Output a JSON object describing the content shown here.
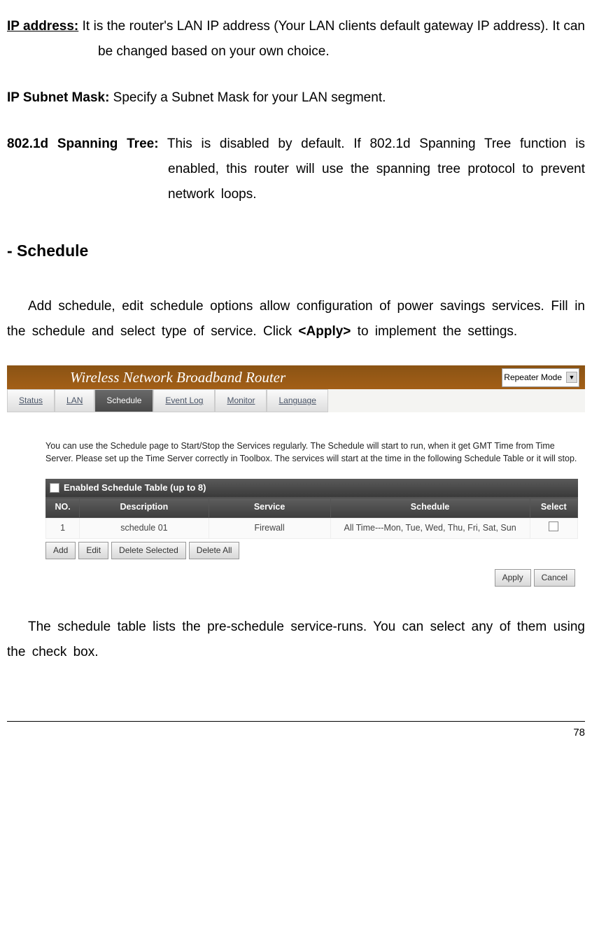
{
  "definitions": {
    "ip_address": {
      "label": "IP address:",
      "text": " It is the router's LAN IP address (Your LAN clients default gateway IP address). It can be changed based on your own choice."
    },
    "subnet": {
      "label": "IP Subnet Mask:",
      "text": " Specify a Subnet Mask for your LAN segment."
    },
    "spanning": {
      "label": "802.1d Spanning Tree:",
      "text": " This is disabled by default. If 802.1d Spanning Tree function is enabled, this router will use the spanning tree protocol to prevent network loops."
    }
  },
  "section_heading": "- Schedule",
  "intro_para_pre": "Add schedule, edit schedule options allow configuration of power savings services. Fill in the schedule and select type of service. Click ",
  "intro_para_bold": "<Apply>",
  "intro_para_post": " to implement the settings.",
  "router": {
    "title": "Wireless Network Broadband Router",
    "mode": "Repeater Mode",
    "tabs": {
      "status": "Status",
      "lan": "LAN",
      "schedule": "Schedule",
      "eventlog": "Event Log",
      "monitor": "Monitor",
      "language": "Language"
    },
    "description": "You can use the Schedule page to Start/Stop the Services regularly. The Schedule will start to run, when it get GMT Time from Time Server. Please set up the Time Server correctly in Toolbox. The services will start at the time in the following Schedule Table or it will stop.",
    "enable_label": "Enabled Schedule Table (up to 8)",
    "columns": {
      "no": "NO.",
      "description": "Description",
      "service": "Service",
      "schedule": "Schedule",
      "select": "Select"
    },
    "row1": {
      "no": "1",
      "description": "schedule 01",
      "service": "Firewall",
      "schedule": "All Time---Mon, Tue, Wed, Thu, Fri, Sat, Sun"
    },
    "buttons": {
      "add": "Add",
      "edit": "Edit",
      "delete_selected": "Delete Selected",
      "delete_all": "Delete All",
      "apply": "Apply",
      "cancel": "Cancel"
    }
  },
  "outro_para": "The schedule table lists the pre-schedule service-runs. You can select any of them using the check box.",
  "page_number": "78"
}
